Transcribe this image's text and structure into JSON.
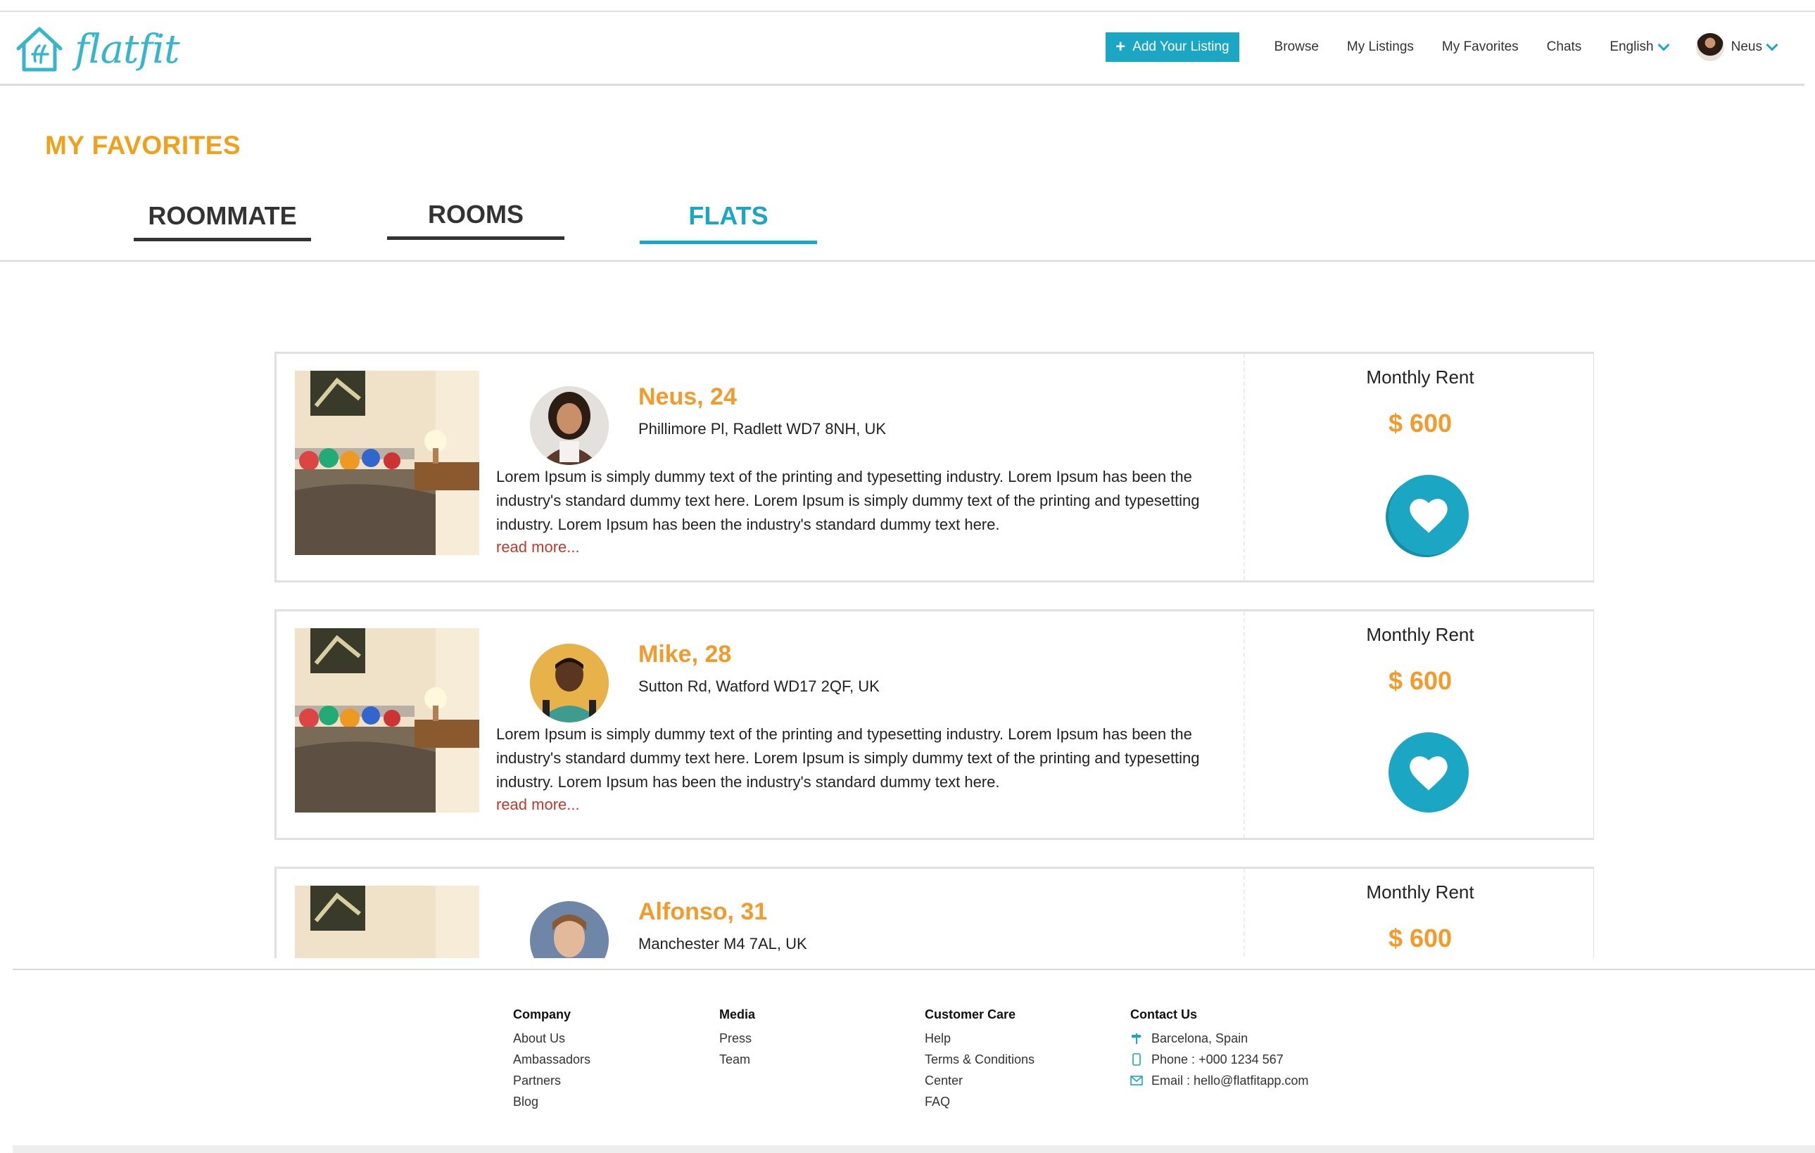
{
  "header": {
    "logo_text": "flatfit",
    "add_listing": "Add Your Listing",
    "nav": [
      "Browse",
      "My Listings",
      "My Favorites",
      "Chats"
    ],
    "language": "English",
    "user_name": "Neus"
  },
  "page": {
    "title": "MY FAVORITES",
    "tabs": [
      "ROOMMATE",
      "ROOMS",
      "FLATS"
    ],
    "active_tab": "FLATS"
  },
  "colors": {
    "brand": "#1ba7c4",
    "accent_orange": "#f39a2b",
    "title_orange": "#f0a01a",
    "read_more": "#c0392b"
  },
  "listings": [
    {
      "name": "Neus, 24",
      "address": "Phillimore Pl, Radlett WD7 8NH, UK",
      "description": "Lorem Ipsum is simply dummy text of the printing and typesetting industry. Lorem Ipsum has been the industry's standard dummy text here. Lorem Ipsum is simply dummy text of the printing and typesetting industry. Lorem Ipsum has been the industry's standard dummy text here.",
      "read_more": "read more...",
      "rent_label": "Monthly Rent",
      "rent": "$ 600"
    },
    {
      "name": "Mike, 28",
      "address": "Sutton Rd, Watford WD17 2QF, UK",
      "description": "Lorem Ipsum is simply dummy text of the printing and typesetting industry. Lorem Ipsum has been the industry's standard dummy text here. Lorem Ipsum is simply dummy text of the printing and typesetting industry. Lorem Ipsum has been the industry's standard dummy text here.",
      "read_more": "read more...",
      "rent_label": "Monthly Rent",
      "rent": "$ 600"
    },
    {
      "name": "Alfonso, 31",
      "address": "Manchester M4 7AL, UK",
      "rent_label": "Monthly Rent",
      "rent": "$ 600"
    }
  ],
  "footer": {
    "company": {
      "heading": "Company",
      "links": [
        "About Us",
        "Ambassadors",
        "Partners",
        "Blog"
      ]
    },
    "media": {
      "heading": "Media",
      "links": [
        "Press",
        "Team"
      ]
    },
    "care": {
      "heading": "Customer Care",
      "links": [
        "Help",
        "Terms & Conditions",
        "Center",
        "FAQ"
      ]
    },
    "contact": {
      "heading": "Contact Us",
      "location": "Barcelona, Spain",
      "phone": "Phone : +000 1234 567",
      "email": "Email : hello@flatfitapp.com"
    }
  }
}
